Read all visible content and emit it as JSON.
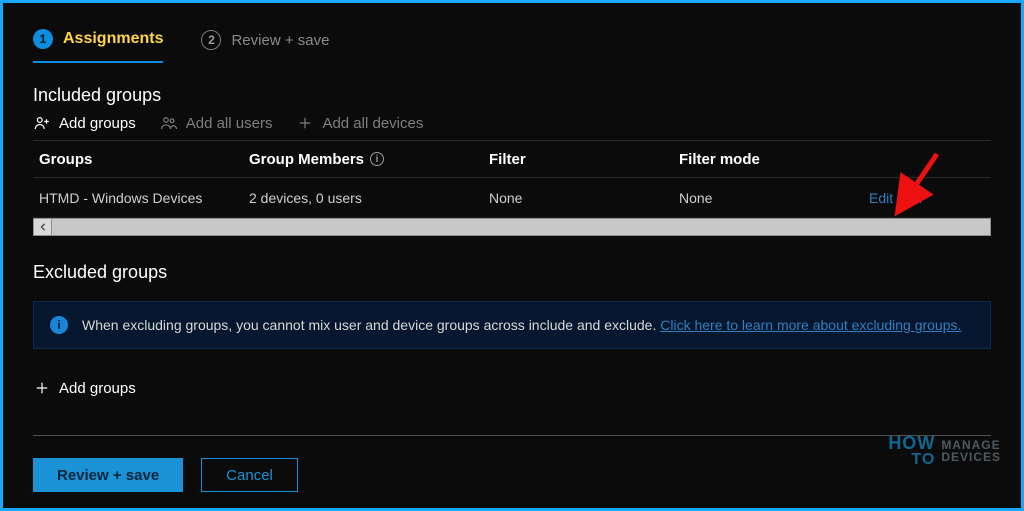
{
  "steps": {
    "s1_num": "1",
    "s1_label": "Assignments",
    "s2_num": "2",
    "s2_label": "Review + save"
  },
  "included": {
    "title": "Included groups",
    "actions": {
      "add_groups": "Add groups",
      "add_all_users": "Add all users",
      "add_all_devices": "Add all devices"
    },
    "columns": {
      "groups": "Groups",
      "members": "Group Members",
      "filter": "Filter",
      "filter_mode": "Filter mode"
    },
    "rows": [
      {
        "group": "HTMD - Windows Devices",
        "members": "2 devices, 0 users",
        "filter": "None",
        "filter_mode": "None",
        "edit": "Edit filter"
      }
    ]
  },
  "excluded": {
    "title": "Excluded groups",
    "banner_text": "When excluding groups, you cannot mix user and device groups across include and exclude. ",
    "banner_link": "Click here to learn more about excluding groups.",
    "add_groups": "Add groups"
  },
  "footer": {
    "primary": "Review + save",
    "secondary": "Cancel"
  },
  "watermark": {
    "how": "HOW",
    "to": "TO",
    "manage": "MANAGE",
    "devices": "DEVICES"
  }
}
